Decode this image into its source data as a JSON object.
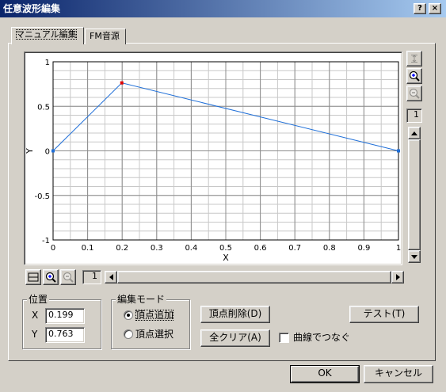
{
  "window": {
    "title": "任意波形編集",
    "help_label": "?",
    "close_label": "×"
  },
  "tabs": [
    {
      "label": "マニュアル編集",
      "active": true
    },
    {
      "label": "FM音源",
      "active": false
    }
  ],
  "chart_data": {
    "type": "line",
    "xlabel": "X",
    "ylabel": "Y",
    "xlim": [
      0,
      1
    ],
    "ylim": [
      -1,
      1
    ],
    "x_ticks": [
      0,
      0.1,
      0.2,
      0.3,
      0.4,
      0.5,
      0.6,
      0.7,
      0.8,
      0.9,
      1
    ],
    "x_tick_labels": [
      "0",
      "0.1",
      "0.2",
      "0.3",
      "0.4",
      "0.5",
      "0.6",
      "0.7",
      "0.8",
      "0.9",
      "1"
    ],
    "y_ticks": [
      1,
      0.5,
      0,
      -0.5,
      -1
    ],
    "y_tick_labels": [
      "1",
      "0.5",
      "0",
      "-0.5",
      "-1"
    ],
    "grid": true,
    "series": [
      {
        "points": [
          {
            "x": 0,
            "y": 0
          },
          {
            "x": 0.199,
            "y": 0.763
          },
          {
            "x": 1,
            "y": 0
          }
        ],
        "line_color": "#1f6fd8",
        "vertex_color": "#1f6fd8",
        "selected_index": 1,
        "selected_color": "#e00000"
      }
    ]
  },
  "plot_tools": {
    "vertical": {
      "fit_icon": "fit-vertical-icon",
      "zoom_in_icon": "zoom-in-icon",
      "zoom_out_icon": "zoom-out-icon",
      "zoom_level": "1"
    },
    "horizontal": {
      "fit_icon": "fit-horizontal-icon",
      "zoom_in_icon": "zoom-in-icon",
      "zoom_out_icon": "zoom-out-icon",
      "zoom_level": "1"
    }
  },
  "position": {
    "title": "位置",
    "x_label": "X",
    "x_value": "0.199",
    "y_label": "Y",
    "y_value": "0.763"
  },
  "edit_mode": {
    "title": "編集モード",
    "options": [
      {
        "label": "頂点追加",
        "selected": true
      },
      {
        "label": "頂点選択",
        "selected": false
      }
    ]
  },
  "actions": {
    "delete_vertex": "頂点削除(D)",
    "clear_all": "全クリア(A)",
    "connect_curve": "曲線でつなぐ",
    "connect_curve_checked": false,
    "test": "テスト(T)"
  },
  "footer": {
    "ok": "OK",
    "cancel": "キャンセル"
  }
}
